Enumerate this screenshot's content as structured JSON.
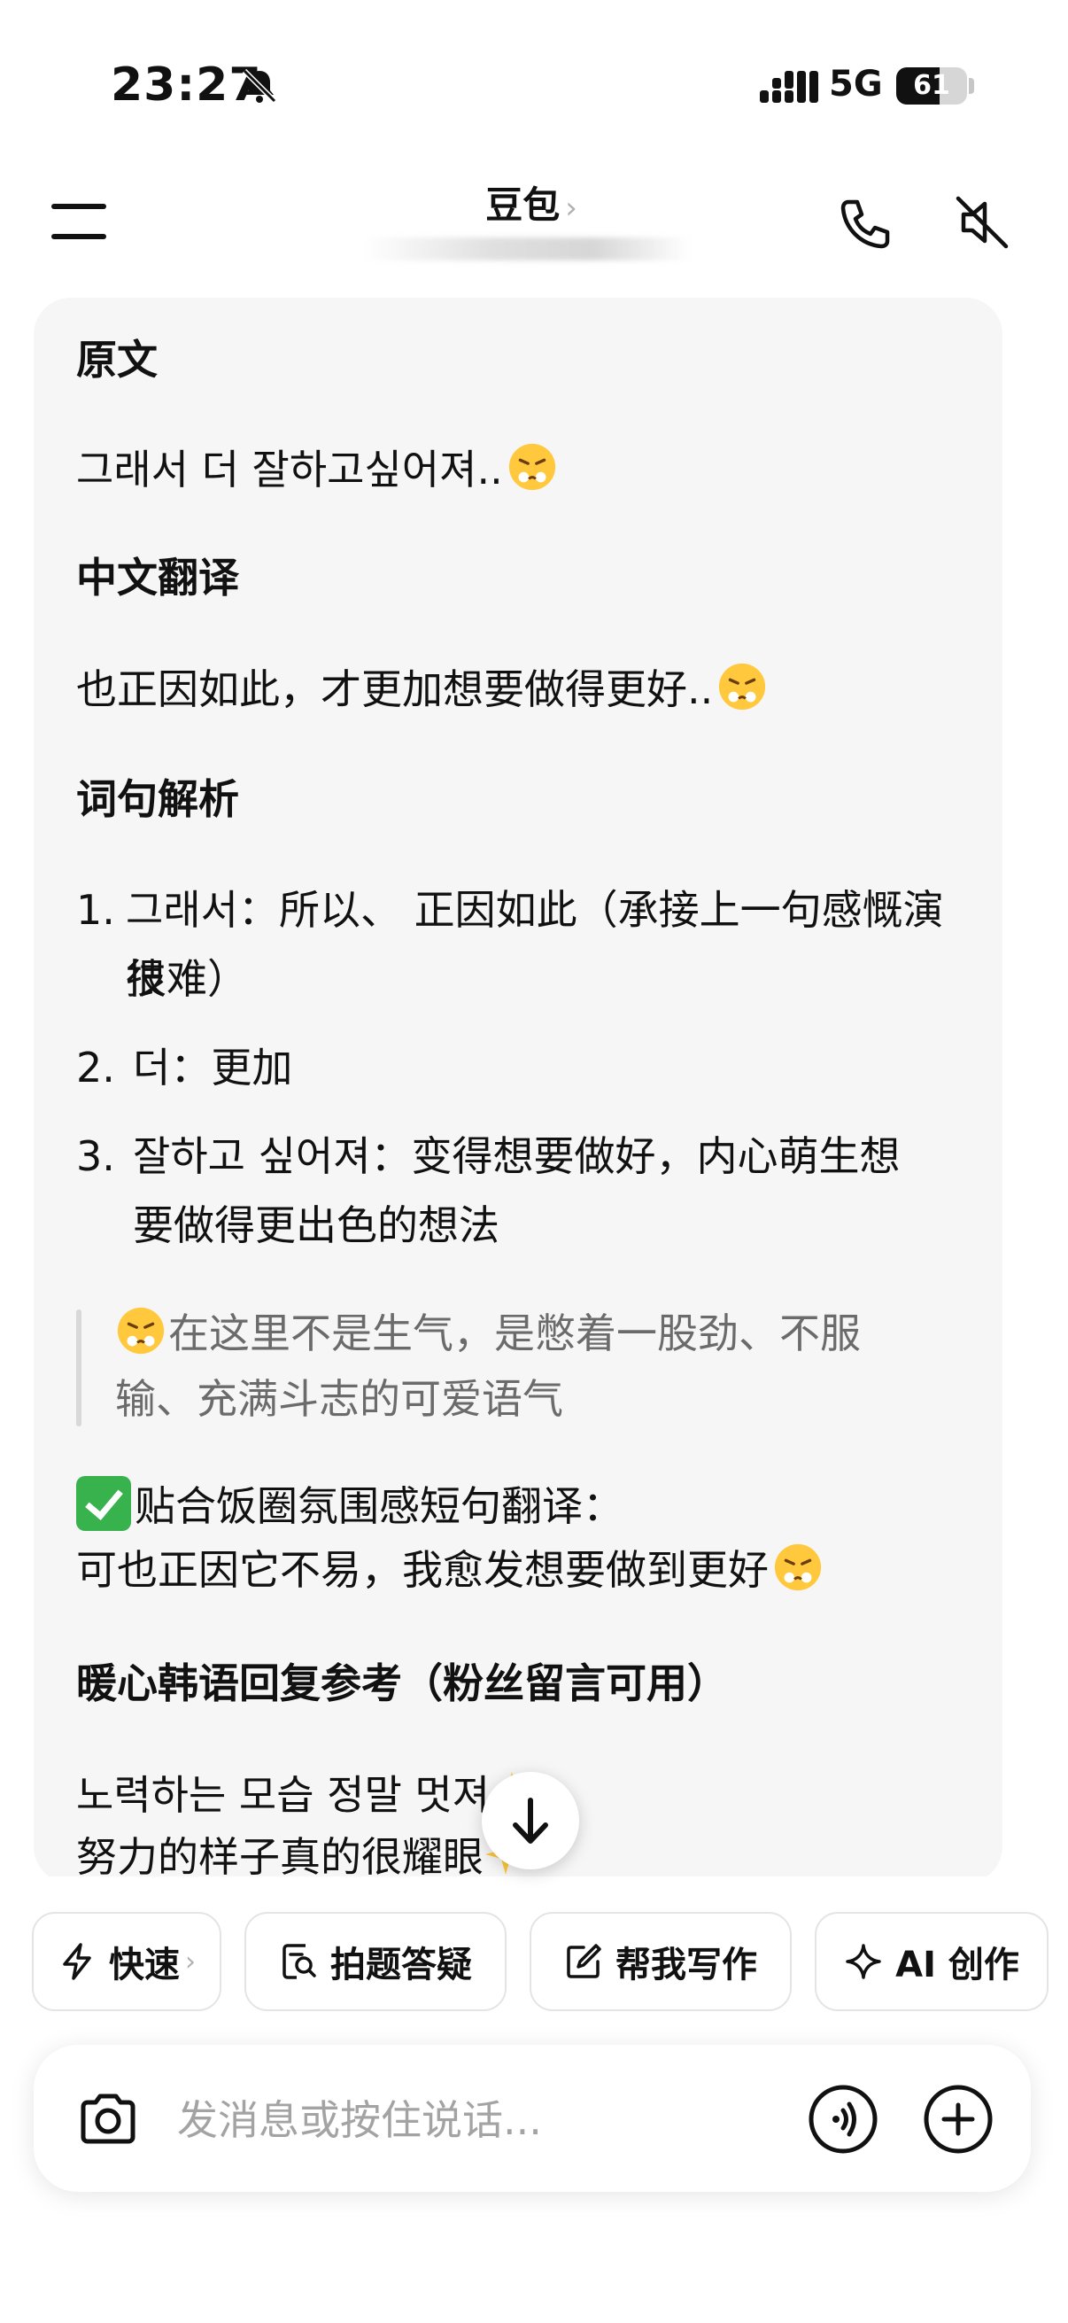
{
  "status_bar": {
    "time": "23:27",
    "network": "5G",
    "battery": "61",
    "battery_level": 0.61
  },
  "header": {
    "title": "豆包",
    "title_chevron": "›"
  },
  "message": {
    "original_heading": "原文",
    "original_text": "그래서 더 잘하고싶어져..",
    "translation_heading": "中文翻译",
    "translation_text": "也正因如此，才更加想要做得更好..",
    "analysis_heading": "词句解析",
    "analysis_items": [
      {
        "num": "1.",
        "line1": "그래서：所以、 正因如此（承接上一句感慨演技",
        "line2": "很难）"
      },
      {
        "num": "2.",
        "line1": "더：更加",
        "line2": ""
      },
      {
        "num": "3.",
        "line1": "잘하고 싶어져：变得想要做好，内心萌生想",
        "line2": "要做得更出色的想法"
      }
    ],
    "quote_line1": "在这里不是生气，是憋着一股劲、不服",
    "quote_line2": "输、充满斗志的可爱语气",
    "fan_heading": "贴合饭圈氛围感短句翻译：",
    "fan_text": "可也正因它不易，我愈发想要做到更好",
    "reply_heading": "暖心韩语回复参考（粉丝留言可用）",
    "reply_ko": "노력하는 모습 정말 멋져",
    "reply_zh": "努力的样子真的很耀眼"
  },
  "chips": [
    {
      "label": "快速",
      "chevron": "›",
      "icon": "lightning-icon"
    },
    {
      "label": "拍题答疑",
      "icon": "photo-search-icon"
    },
    {
      "label": "帮我写作",
      "icon": "edit-icon"
    },
    {
      "label": "AI 创作",
      "icon": "sparkle-icon"
    }
  ],
  "input": {
    "placeholder": "发消息或按住说话..."
  }
}
